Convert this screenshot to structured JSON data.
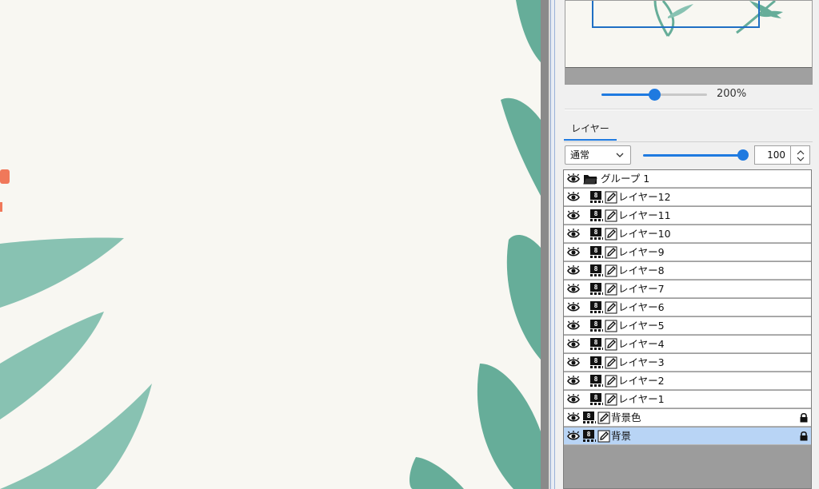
{
  "navigator": {
    "zoom_label": "200%",
    "zoom_fraction": 0.5
  },
  "layers_panel": {
    "tab_label": "レイヤー",
    "blend_mode": "通常",
    "opacity_value": "100",
    "opacity_fraction": 1.0,
    "rows": [
      {
        "label": "グループ 1",
        "kind": "group",
        "visible": true,
        "locked": false,
        "selected": false,
        "indent": 0
      },
      {
        "label": "レイヤー12",
        "kind": "layer",
        "bit": "8",
        "visible": true,
        "locked": false,
        "selected": false,
        "indent": 1
      },
      {
        "label": "レイヤー11",
        "kind": "layer",
        "bit": "8",
        "visible": true,
        "locked": false,
        "selected": false,
        "indent": 1
      },
      {
        "label": "レイヤー10",
        "kind": "layer",
        "bit": "8",
        "visible": true,
        "locked": false,
        "selected": false,
        "indent": 1
      },
      {
        "label": "レイヤー9",
        "kind": "layer",
        "bit": "8",
        "visible": true,
        "locked": false,
        "selected": false,
        "indent": 1
      },
      {
        "label": "レイヤー8",
        "kind": "layer",
        "bit": "8",
        "visible": true,
        "locked": false,
        "selected": false,
        "indent": 1
      },
      {
        "label": "レイヤー7",
        "kind": "layer",
        "bit": "8",
        "visible": true,
        "locked": false,
        "selected": false,
        "indent": 1
      },
      {
        "label": "レイヤー6",
        "kind": "layer",
        "bit": "8",
        "visible": true,
        "locked": false,
        "selected": false,
        "indent": 1
      },
      {
        "label": "レイヤー5",
        "kind": "layer",
        "bit": "8",
        "visible": true,
        "locked": false,
        "selected": false,
        "indent": 1
      },
      {
        "label": "レイヤー4",
        "kind": "layer",
        "bit": "8",
        "visible": true,
        "locked": false,
        "selected": false,
        "indent": 1
      },
      {
        "label": "レイヤー3",
        "kind": "layer",
        "bit": "8",
        "visible": true,
        "locked": false,
        "selected": false,
        "indent": 1
      },
      {
        "label": "レイヤー2",
        "kind": "layer",
        "bit": "8",
        "visible": true,
        "locked": false,
        "selected": false,
        "indent": 1
      },
      {
        "label": "レイヤー1",
        "kind": "layer",
        "bit": "8",
        "visible": true,
        "locked": false,
        "selected": false,
        "indent": 1
      },
      {
        "label": "背景色",
        "kind": "layer",
        "bit": "8",
        "visible": true,
        "locked": true,
        "selected": false,
        "indent": 0
      },
      {
        "label": "背景",
        "kind": "layer",
        "bit": "8",
        "visible": true,
        "locked": true,
        "selected": true,
        "indent": 0
      }
    ]
  },
  "icons": {
    "visibility": "eye-icon",
    "group": "folder-icon",
    "bit_depth": "bit-depth-icon",
    "edit": "pencil-icon",
    "lock": "lock-icon",
    "dropdown": "chevron-down-icon",
    "spinner": "spinner-icon"
  },
  "colors": {
    "accent": "#1f7ae0",
    "canvas_bg": "#f8f7f2",
    "leaf_dark": "#66ad99",
    "leaf_light": "#88c2b2",
    "flower": "#f0785a",
    "selected_row": "#b8d4f5"
  }
}
